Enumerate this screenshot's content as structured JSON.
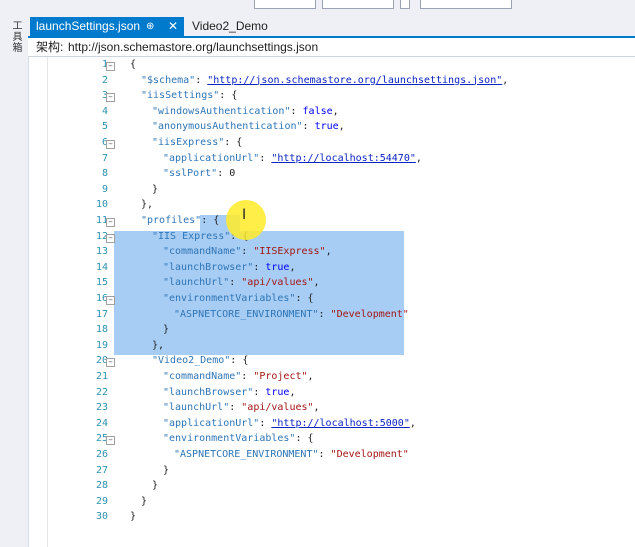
{
  "sidebar": {
    "label": "工具箱"
  },
  "tabs": [
    {
      "label": "launchSettings.json",
      "pin": "⊕",
      "close": "✕",
      "active": true
    },
    {
      "label": "Video2_Demo",
      "active": false
    }
  ],
  "schema": {
    "label": "架构:",
    "url": "http://json.schemastore.org/launchsettings.json"
  },
  "editor": {
    "lines": [
      {
        "n": "1"
      },
      {
        "n": "2"
      },
      {
        "n": "3"
      },
      {
        "n": "4"
      },
      {
        "n": "5"
      },
      {
        "n": "6"
      },
      {
        "n": "7"
      },
      {
        "n": "8"
      },
      {
        "n": "9"
      },
      {
        "n": "10"
      },
      {
        "n": "11"
      },
      {
        "n": "12"
      },
      {
        "n": "13"
      },
      {
        "n": "14"
      },
      {
        "n": "15"
      },
      {
        "n": "16"
      },
      {
        "n": "17"
      },
      {
        "n": "18"
      },
      {
        "n": "19"
      },
      {
        "n": "20"
      },
      {
        "n": "21"
      },
      {
        "n": "22"
      },
      {
        "n": "23"
      },
      {
        "n": "24"
      },
      {
        "n": "25"
      },
      {
        "n": "26"
      },
      {
        "n": "27"
      },
      {
        "n": "28"
      },
      {
        "n": "29"
      },
      {
        "n": "30"
      }
    ],
    "tokens": {
      "l1_brace": "{",
      "l2_key": "\"$schema\"",
      "l2_val": "\"http://json.schemastore.org/launchsettings.json\"",
      "l3_key": "\"iisSettings\"",
      "l4_key": "\"windowsAuthentication\"",
      "l4_val": "false",
      "l5_key": "\"anonymousAuthentication\"",
      "l5_val": "true",
      "l6_key": "\"iisExpress\"",
      "l7_key": "\"applicationUrl\"",
      "l7_val": "\"http://localhost:54470\"",
      "l8_key": "\"sslPort\"",
      "l8_val": "0",
      "l9": "}",
      "l10": "},",
      "l11_key": "\"profiles\"",
      "l12_key": "\"IIS Express\"",
      "l13_key": "\"commandName\"",
      "l13_val": "\"IISExpress\"",
      "l14_key": "\"launchBrowser\"",
      "l14_val": "true",
      "l15_key": "\"launchUrl\"",
      "l15_val": "\"api/values\"",
      "l16_key": "\"environmentVariables\"",
      "l17_key": "\"ASPNETCORE_ENVIRONMENT\"",
      "l17_val": "\"Development\"",
      "l18": "}",
      "l19": "},",
      "l20_key": "\"Video2_Demo\"",
      "l21_key": "\"commandName\"",
      "l21_val": "\"Project\"",
      "l22_key": "\"launchBrowser\"",
      "l22_val": "true",
      "l23_key": "\"launchUrl\"",
      "l23_val": "\"api/values\"",
      "l24_key": "\"applicationUrl\"",
      "l24_val": "\"http://localhost:5000\"",
      "l25_key": "\"environmentVariables\"",
      "l26_key": "\"ASPNETCORE_ENVIRONMENT\"",
      "l26_val": "\"Development\"",
      "l27": "}",
      "l28": "}",
      "l29": "}",
      "l30": "}"
    }
  },
  "colors": {
    "tab_active": "#007acc",
    "key": "#2e75b6",
    "string": "#a31515",
    "literal": "#0000ff",
    "selection": "#a8cdf4",
    "line_number": "#2b91af"
  }
}
